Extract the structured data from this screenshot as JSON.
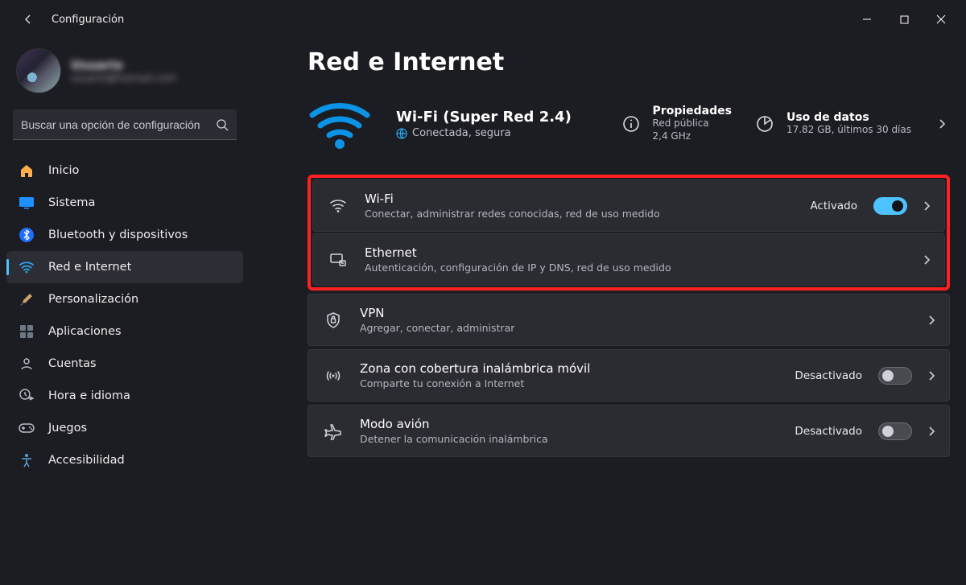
{
  "app_title": "Configuración",
  "search_placeholder": "Buscar una opción de configuración",
  "profile": {
    "name": "Usuario",
    "email": "usuario@hotmail.com"
  },
  "sidebar": {
    "items": [
      {
        "label": "Inicio",
        "icon": "home-icon"
      },
      {
        "label": "Sistema",
        "icon": "system-icon"
      },
      {
        "label": "Bluetooth y dispositivos",
        "icon": "bluetooth-icon"
      },
      {
        "label": "Red e Internet",
        "icon": "wifi-icon"
      },
      {
        "label": "Personalización",
        "icon": "paintbrush-icon"
      },
      {
        "label": "Aplicaciones",
        "icon": "apps-icon"
      },
      {
        "label": "Cuentas",
        "icon": "person-icon"
      },
      {
        "label": "Hora e idioma",
        "icon": "clock-language-icon"
      },
      {
        "label": "Juegos",
        "icon": "gamepad-icon"
      },
      {
        "label": "Accesibilidad",
        "icon": "accessibility-icon"
      }
    ]
  },
  "page": {
    "title": "Red e Internet",
    "connection": {
      "name": "Wi-Fi (Super Red 2.4)",
      "status": "Conectada, segura"
    },
    "properties": {
      "label": "Propiedades",
      "line1": "Red pública",
      "line2": "2,4 GHz"
    },
    "data_usage": {
      "label": "Uso de datos",
      "line1": "17.82 GB, últimos 30 días"
    },
    "rows": {
      "wifi": {
        "title": "Wi-Fi",
        "sub": "Conectar, administrar redes conocidas, red de uso medido",
        "status": "Activado"
      },
      "ethernet": {
        "title": "Ethernet",
        "sub": "Autenticación, configuración de IP y DNS, red de uso medido"
      },
      "vpn": {
        "title": "VPN",
        "sub": "Agregar, conectar, administrar"
      },
      "hotspot": {
        "title": "Zona con cobertura inalámbrica móvil",
        "sub": "Comparte tu conexión a Internet",
        "status": "Desactivado"
      },
      "airplane": {
        "title": "Modo avión",
        "sub": "Detener la comunicación inalámbrica",
        "status": "Desactivado"
      }
    }
  }
}
